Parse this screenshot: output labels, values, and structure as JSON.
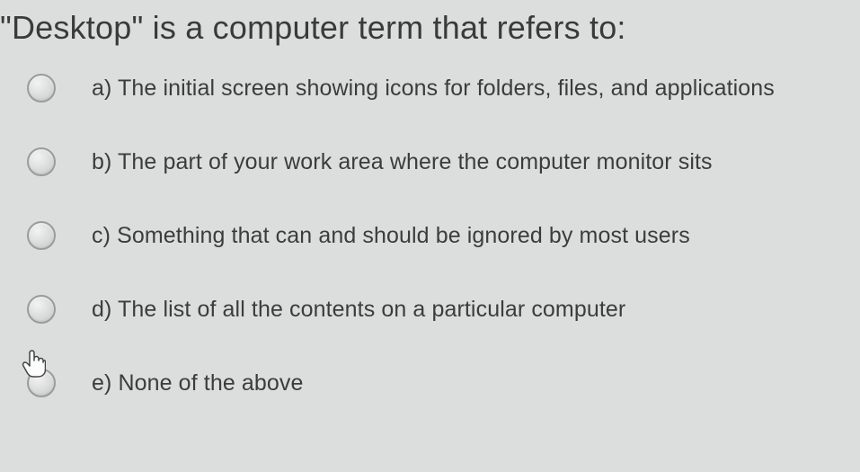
{
  "question": {
    "title": "\"Desktop\" is a computer term that refers to:"
  },
  "options": [
    {
      "label": "a) The initial screen showing icons for folders, files, and applications"
    },
    {
      "label": "b) The part of your work area where the computer monitor sits"
    },
    {
      "label": "c) Something that can and should be ignored by most users"
    },
    {
      "label": "d) The list of all the contents on a particular computer"
    },
    {
      "label": "e) None of the above"
    }
  ]
}
